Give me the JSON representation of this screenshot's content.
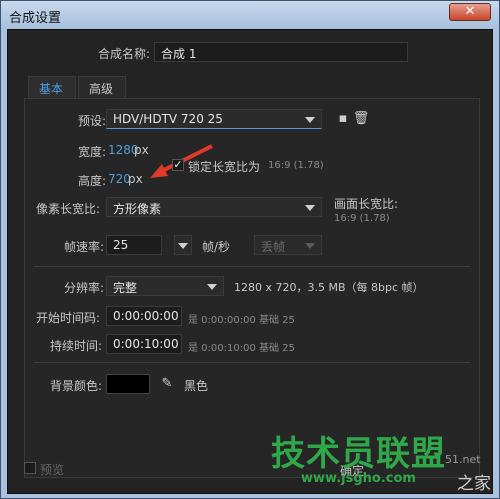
{
  "window": {
    "title": "合成设置",
    "close_label": "✕"
  },
  "composition": {
    "name_label": "合成名称:",
    "name_value": "合成 1"
  },
  "tabs": [
    {
      "label": "基本"
    },
    {
      "label": "高级"
    }
  ],
  "preset": {
    "label": "预设:",
    "value": "HDV/HDTV 720 25"
  },
  "width": {
    "label": "宽度:",
    "value": "1280",
    "unit": "px"
  },
  "lock_aspect": {
    "label": "锁定长宽比为",
    "value": "16:9 (1.78)",
    "checked": true
  },
  "height": {
    "label": "高度:",
    "value": "720",
    "unit": "px"
  },
  "pixel_aspect": {
    "label": "像素长宽比:",
    "value": "方形像素"
  },
  "frame_aspect": {
    "label": "画面长宽比:",
    "value": "16:9 (1.78)"
  },
  "frame_rate": {
    "label": "帧速率:",
    "value": "25",
    "unit": "帧/秒",
    "drop_frame": "丢帧"
  },
  "resolution": {
    "label": "分辨率:",
    "value": "完整",
    "info": "1280 x 720，3.5 MB（每 8bpc 帧）"
  },
  "start_timecode": {
    "label": "开始时间码:",
    "value": "0:00:00:00",
    "info": "是 0:00:00:00  基础 25"
  },
  "duration": {
    "label": "持续时间:",
    "value": "0:00:10:00",
    "info": "是 0:00:10:00  基础 25"
  },
  "background": {
    "label": "背景颜色:",
    "color_name": "黑色",
    "color": "#000000"
  },
  "preview": {
    "label": "预览"
  },
  "ok_button": {
    "label": "确定"
  },
  "watermark": {
    "text": "技术员联盟",
    "url": "www.jsgho.com",
    "right_text": "之家",
    "partial": "51.net"
  }
}
